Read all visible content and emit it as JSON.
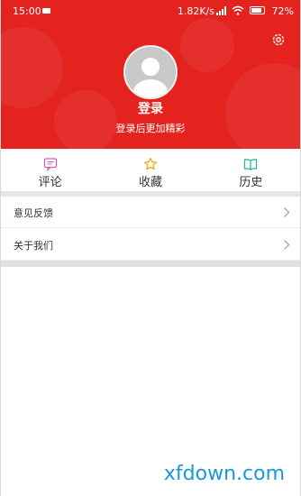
{
  "status_bar": {
    "time": "15:00",
    "network_speed": "1.82K/s",
    "battery": "72%"
  },
  "profile": {
    "login_label": "登录",
    "login_subtitle": "登录后更加精彩"
  },
  "quick_nav": [
    {
      "label": "评论",
      "icon": "comment-icon",
      "color": "#d45ab3"
    },
    {
      "label": "收藏",
      "icon": "star-icon",
      "color": "#e8a800"
    },
    {
      "label": "历史",
      "icon": "book-icon",
      "color": "#1ab3a0"
    }
  ],
  "menu": [
    {
      "label": "意见反馈"
    },
    {
      "label": "关于我们"
    }
  ],
  "watermark": "xfdown.com",
  "colors": {
    "header": "#e4231f",
    "watermark": "#1a96d9"
  }
}
